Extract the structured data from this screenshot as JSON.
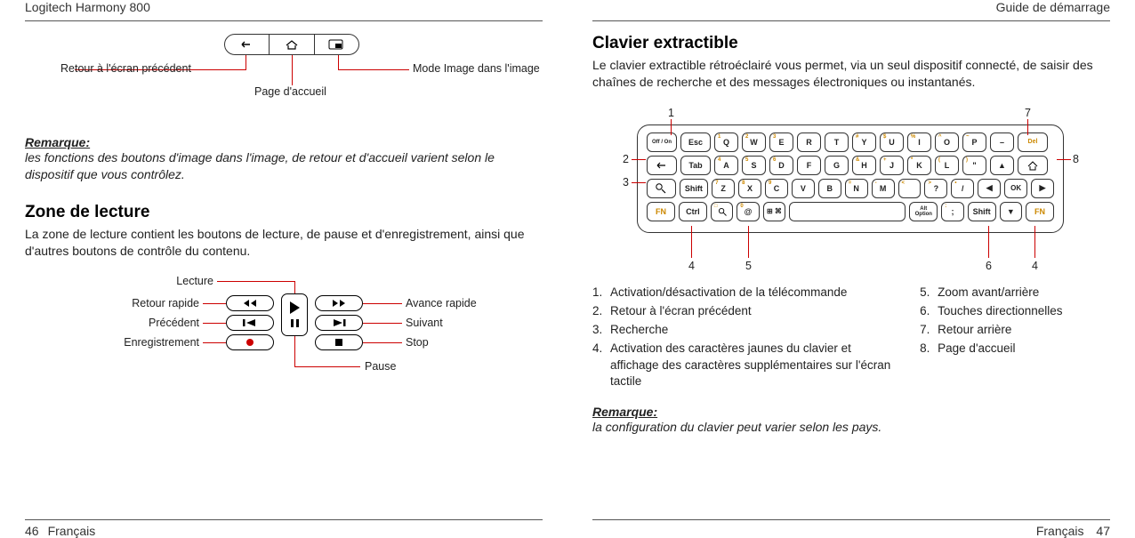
{
  "doc_title": "Logitech Harmony 800",
  "guide_title": "Guide de démarrage",
  "page_left_num": "46",
  "page_right_num": "47",
  "lang": "Français",
  "top_diagram": {
    "back_label": "Retour à l'écran précédent",
    "home_label": "Page d'accueil",
    "pip_label": "Mode Image dans l'image"
  },
  "note1": {
    "heading": "Remarque:",
    "body": "les fonctions des boutons d'image dans l'image, de retour et d'accueil varient selon le dispositif que vous contrôlez."
  },
  "section_playback_h": "Zone de lecture",
  "section_playback_p": "La zone de lecture contient les boutons de lecture, de pause et d'enregistrement, ainsi que d'autres boutons de contrôle du contenu.",
  "play_labels": {
    "play": "Lecture",
    "rew": "Retour rapide",
    "prev": "Précédent",
    "rec": "Enregistrement",
    "ffwd": "Avance rapide",
    "next": "Suivant",
    "stop": "Stop",
    "pause": "Pause"
  },
  "section_kbd_h": "Clavier extractible",
  "section_kbd_p": "Le clavier extractible rétroéclairé vous permet, via un seul dispositif connecté, de saisir des chaînes de recherche et des messages électroniques ou instantanés.",
  "kbd_callouts": {
    "n1": "1",
    "n2": "2",
    "n3": "3",
    "n4": "4",
    "n5": "5",
    "n6": "6",
    "n7": "7",
    "n8": "8"
  },
  "keys": {
    "offon": "Off / On",
    "esc": "Esc",
    "tab": "Tab",
    "shift": "Shift",
    "ctrl": "Ctrl",
    "fn": "FN",
    "alt": "Alt\nOption",
    "ok": "OK",
    "del": "Del",
    "row1": [
      "Q",
      "W",
      "E",
      "R",
      "T",
      "Y",
      "U",
      "I",
      "O",
      "P"
    ],
    "row1_sup": [
      "1",
      "2",
      "3",
      "",
      "",
      "#",
      "$",
      "%",
      "^",
      "~"
    ],
    "row2": [
      "A",
      "S",
      "D",
      "F",
      "G",
      "H",
      "J",
      "K",
      "L",
      "\""
    ],
    "row2_sup": [
      "4",
      "5",
      "6",
      "",
      "",
      "&",
      "+",
      "*",
      "(",
      ")"
    ],
    "row3": [
      "Z",
      "X",
      "C",
      "V",
      "B",
      "N",
      "M",
      "",
      "?",
      "/"
    ],
    "row3_sup": [
      "7",
      "8",
      "9",
      "",
      "",
      "=",
      "-",
      "<",
      ">",
      "•"
    ],
    "at": "@",
    "at_sup": "0"
  },
  "list_a": [
    {
      "n": "1.",
      "t": "Activation/désactivation de la télécommande"
    },
    {
      "n": "2.",
      "t": "Retour à l'écran précédent"
    },
    {
      "n": "3.",
      "t": "Recherche"
    },
    {
      "n": "4.",
      "t": "Activation des caractères jaunes du clavier et affichage des caractères supplémentaires sur l'écran tactile"
    }
  ],
  "list_b": [
    {
      "n": "5.",
      "t": "Zoom avant/arrière"
    },
    {
      "n": "6.",
      "t": "Touches directionnelles"
    },
    {
      "n": "7.",
      "t": "Retour arrière"
    },
    {
      "n": "8.",
      "t": "Page d'accueil"
    }
  ],
  "note2": {
    "heading": "Remarque:",
    "body": "la configuration du clavier peut varier selon les pays."
  }
}
